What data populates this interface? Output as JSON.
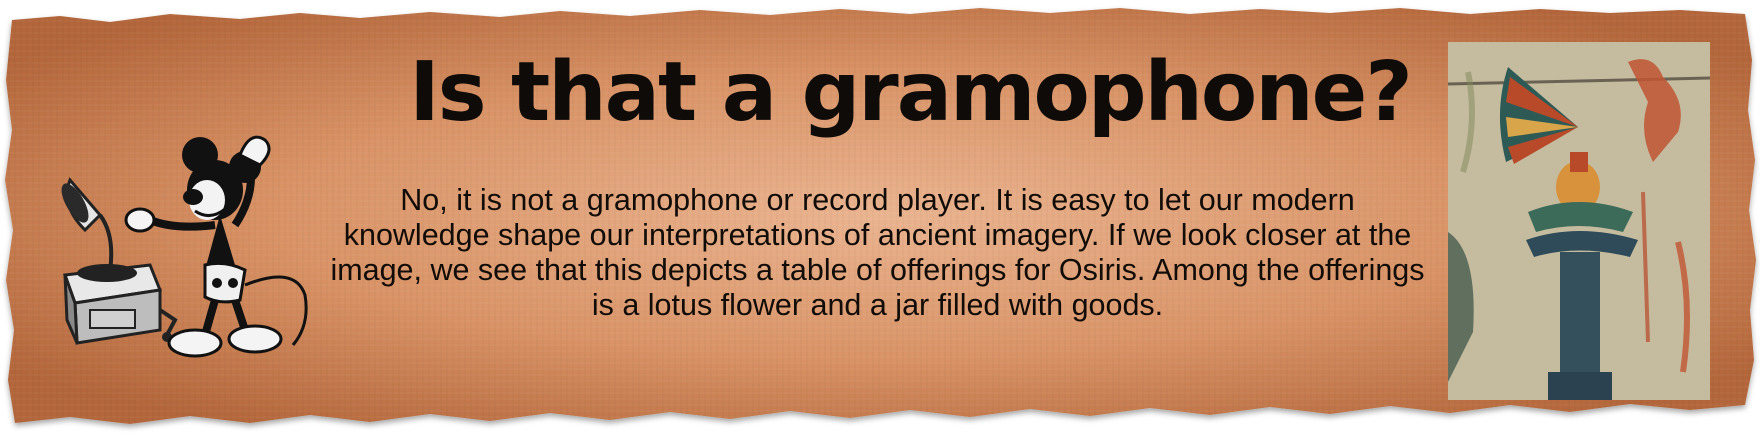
{
  "banner": {
    "title": "Is that a gramophone?",
    "body": "No, it is not a gramophone or record player. It is easy to let our modern knowledge shape our interpretations of ancient imagery. If we look closer at the image, we see that this depicts a table of offerings for Osiris. Among the offerings is a lotus flower and a jar filled with goods."
  },
  "illustrations": {
    "left": "mickey-with-gramophone-icon",
    "right": "egyptian-offering-table-painting-icon"
  },
  "colors": {
    "parchment_center": "#e9ae8b",
    "parchment_edge": "#b66a3e",
    "text": "#110c08"
  }
}
